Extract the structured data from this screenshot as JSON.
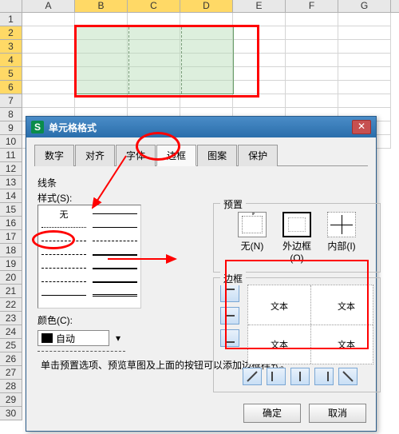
{
  "columns": [
    "A",
    "B",
    "C",
    "D",
    "E",
    "F",
    "G"
  ],
  "dialog": {
    "title": "单元格格式",
    "tabs": [
      "数字",
      "对齐",
      "字体",
      "边框",
      "图案",
      "保护"
    ],
    "active_tab": "边框",
    "line_section": "线条",
    "style_label": "样式(S):",
    "style_none": "无",
    "color_label": "颜色(C):",
    "color_value": "自动",
    "preset_legend": "预置",
    "presets": {
      "none": "无(N)",
      "outline": "外边框(O)",
      "inside": "内部(I)"
    },
    "border_legend": "边框",
    "preview_text": "文本",
    "hint": "单击预置选项、预览草图及上面的按钮可以添加边框样式。",
    "ok": "确定",
    "cancel": "取消"
  }
}
